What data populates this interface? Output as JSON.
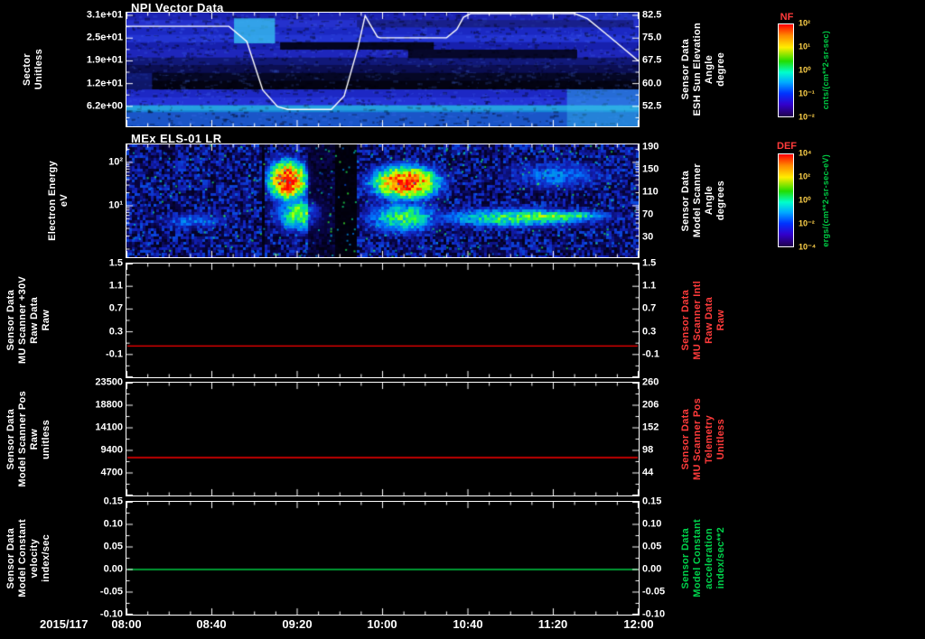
{
  "x_axis": {
    "date": "2015/117",
    "tick_labels": [
      "08:00",
      "08:40",
      "09:20",
      "10:00",
      "10:40",
      "11:20",
      "12:00"
    ]
  },
  "chart_data": [
    {
      "type": "heatmap",
      "title": "NPI Vector Data",
      "left_label_lines": [
        "Sector",
        "Unitless"
      ],
      "left_tick_labels": [
        "3.1e+01",
        "2.5e+01",
        "1.9e+01",
        "1.2e+01",
        "6.2e+00"
      ],
      "right_label_lines": [
        "Sensor Data",
        "ESH Sun Elevation",
        "Angle",
        "degree"
      ],
      "right_tick_labels": [
        "82.5",
        "75.0",
        "67.5",
        "60.0",
        "52.5"
      ],
      "colorbar": {
        "name": "NF",
        "tick_labels": [
          "10²",
          "10¹",
          "10⁰",
          "10⁻¹",
          "10⁻²"
        ],
        "unit": "cnts/(cm**2-sr-sec)"
      },
      "time_range": [
        "08:00",
        "12:00"
      ],
      "overlay_line": {
        "name": "ESH Sun Elevation Angle",
        "color": "#ffffff",
        "y_range": [
          46,
          83.5
        ],
        "points_t_deg": [
          [
            0,
            79
          ],
          [
            0.2,
            79
          ],
          [
            0.235,
            74
          ],
          [
            0.266,
            58
          ],
          [
            0.295,
            52.5
          ],
          [
            0.315,
            51.6
          ],
          [
            0.4,
            51.6
          ],
          [
            0.425,
            56
          ],
          [
            0.452,
            72
          ],
          [
            0.466,
            82.5
          ],
          [
            0.476,
            79.5
          ],
          [
            0.49,
            75.5
          ],
          [
            0.495,
            75.2
          ],
          [
            0.625,
            75.2
          ],
          [
            0.645,
            78
          ],
          [
            0.658,
            82
          ],
          [
            0.672,
            83.2
          ],
          [
            0.875,
            83.2
          ],
          [
            0.9,
            81.5
          ],
          [
            0.94,
            76
          ],
          [
            1.0,
            67.5
          ]
        ]
      },
      "heatmap_rows": [
        {
          "y": [
            0,
            0.065
          ],
          "c": "#1c22b2"
        },
        {
          "y": [
            0.065,
            0.13
          ],
          "c": "#2531cd"
        },
        {
          "y": [
            0.13,
            0.195
          ],
          "c": "#1b28c2"
        },
        {
          "y": [
            0.195,
            0.26
          ],
          "c": "#2334d2"
        },
        {
          "y": [
            0.26,
            0.325
          ],
          "c": "#1720ad"
        },
        {
          "y": [
            0.325,
            0.395
          ],
          "c": "#1e26bb"
        },
        {
          "y": [
            0.395,
            0.46
          ],
          "c": "#111878"
        },
        {
          "y": [
            0.46,
            0.53
          ],
          "c": "#0b0e52"
        },
        {
          "y": [
            0.53,
            0.6
          ],
          "c": "#050725"
        },
        {
          "y": [
            0.6,
            0.675
          ],
          "c": "#030312"
        },
        {
          "y": [
            0.675,
            0.745
          ],
          "c": "#1d28c4"
        },
        {
          "y": [
            0.745,
            0.815
          ],
          "c": "#2433d6"
        },
        {
          "y": [
            0.815,
            0.875
          ],
          "c": "#1686d6"
        },
        {
          "y": [
            0.875,
            1.0
          ],
          "c": "#1a55c8"
        }
      ],
      "features": [
        {
          "x": [
            0.21,
            0.29
          ],
          "y": [
            0.05,
            0.27
          ],
          "c": "#38c8f2",
          "a": 0.75
        },
        {
          "x": [
            0.3,
            0.6
          ],
          "y": [
            0.26,
            0.325
          ],
          "c": "#000006",
          "a": 0.85
        },
        {
          "x": [
            0.55,
            0.88
          ],
          "y": [
            0.325,
            0.4
          ],
          "c": "#000006",
          "a": 0.8
        },
        {
          "x": [
            0.45,
            0.99
          ],
          "y": [
            0.065,
            0.13
          ],
          "c": "#000010",
          "a": 0.35
        },
        {
          "x": [
            0.86,
            1.0
          ],
          "y": [
            0.675,
            1.0
          ],
          "c": "#2fb0e8",
          "a": 0.5
        },
        {
          "x": [
            0.0,
            1.0
          ],
          "y": [
            0.815,
            0.86
          ],
          "c": "#3cc8ee",
          "a": 0.4
        },
        {
          "x": [
            0.88,
            1.0
          ],
          "y": [
            0.0,
            0.065
          ],
          "c": "#3050e0",
          "a": 0.4
        },
        {
          "x": [
            0.0,
            0.05
          ],
          "y": [
            0.53,
            0.675
          ],
          "c": "#1a2cc0",
          "a": 0.5
        }
      ]
    },
    {
      "type": "heatmap",
      "title": "MEx ELS-01 LR",
      "left_label_lines": [
        "Electron Energy",
        "eV"
      ],
      "left_tick_labels": [
        "10²",
        "10¹"
      ],
      "right_label_lines": [
        "Sensor Data",
        "Model Scanner",
        "Angle",
        "degrees"
      ],
      "right_tick_labels": [
        "190",
        "150",
        "110",
        "70",
        "30"
      ],
      "colorbar": {
        "name": "DEF",
        "tick_labels": [
          "10⁴",
          "10²",
          "10⁰",
          "10⁻²",
          "10⁻⁴"
        ],
        "unit": "ergs/(cm**2-sr-sec-eV)"
      },
      "energy_range_ev": [
        0.65,
        260
      ],
      "noise": 0.22,
      "blobs": [
        {
          "t": [
            0.255,
            0.375
          ],
          "f": [
            0.04,
            0.6
          ],
          "peak": 1.05
        },
        {
          "t": [
            0.26,
            0.42
          ],
          "f": [
            0.35,
            0.88
          ],
          "peak": 0.55
        },
        {
          "t": [
            0.44,
            0.65
          ],
          "f": [
            0.1,
            0.58
          ],
          "peak": 0.98
        },
        {
          "t": [
            0.42,
            0.66
          ],
          "f": [
            0.4,
            0.9
          ],
          "peak": 0.5
        },
        {
          "t": [
            0.5,
            1.02
          ],
          "f": [
            0.5,
            0.8
          ],
          "peak": 0.5
        },
        {
          "t": [
            0.63,
            1.02
          ],
          "f": [
            0.55,
            0.72
          ],
          "peak": 0.58
        },
        {
          "t": [
            0.0,
            0.26
          ],
          "f": [
            0.55,
            0.8
          ],
          "peak": 0.3
        },
        {
          "t": [
            0.66,
            1.02
          ],
          "f": [
            0.05,
            0.5
          ],
          "peak": 0.3
        }
      ],
      "gaps": [
        [
          0.405,
          0.45,
          0.08
        ],
        [
          0.262,
          0.272,
          0.2
        ],
        [
          0.355,
          0.405,
          0.5
        ]
      ]
    },
    {
      "type": "line",
      "left_label_lines": [
        "Sensor Data",
        "MU Scanner +30V",
        "Raw Data",
        "Raw"
      ],
      "left_tick_labels": [
        "1.5",
        "1.1",
        "0.7",
        "0.3",
        "-0.1"
      ],
      "right_label_lines": [
        "Sensor Data",
        "MU Scanner Intl",
        "Raw Data",
        "Raw"
      ],
      "right_tick_labels": [
        "1.5",
        "1.1",
        "0.7",
        "0.3",
        "-0.1"
      ],
      "right_label_color": "#ff3b3b",
      "line_color": "#ff0000",
      "ylim": [
        -0.5,
        1.5
      ],
      "series": [
        {
          "name": "MU Scanner +30V Raw Data",
          "constant_value": 0.05
        }
      ]
    },
    {
      "type": "line",
      "left_label_lines": [
        "Sensor Data",
        "Model Scanner Pos",
        "Raw",
        "unitless"
      ],
      "left_tick_labels": [
        "23500",
        "18800",
        "14100",
        "9400",
        "4700"
      ],
      "right_label_lines": [
        "Sensor Data",
        "MU Scanner Pos",
        "Telemetry",
        "Unitless"
      ],
      "right_tick_labels": [
        "260",
        "206",
        "152",
        "98",
        "44"
      ],
      "right_label_color": "#ff3b3b",
      "right_ylim": [
        -10,
        260
      ],
      "line_color": "#ff0000",
      "ylim": [
        0,
        23500
      ],
      "series": [
        {
          "name": "Model Scanner Pos Raw",
          "constant_value": 7900
        }
      ]
    },
    {
      "type": "line",
      "left_label_lines": [
        "Sensor Data",
        "Model Constant",
        "velocity",
        "index/sec"
      ],
      "left_tick_labels": [
        "0.15",
        "0.10",
        "0.05",
        "0.00",
        "-0.05",
        "-0.10"
      ],
      "right_label_lines": [
        "Sensor Data",
        "Model Constant",
        "acceleration",
        "index/sec**2"
      ],
      "right_tick_labels": [
        "0.15",
        "0.10",
        "0.05",
        "0.00",
        "-0.05",
        "-0.10"
      ],
      "right_label_color": "#00d24b",
      "line_color": "#00cc44",
      "ylim": [
        -0.1,
        0.15
      ],
      "series": [
        {
          "name": "Model Constant velocity",
          "constant_value": 0.0
        }
      ]
    }
  ]
}
